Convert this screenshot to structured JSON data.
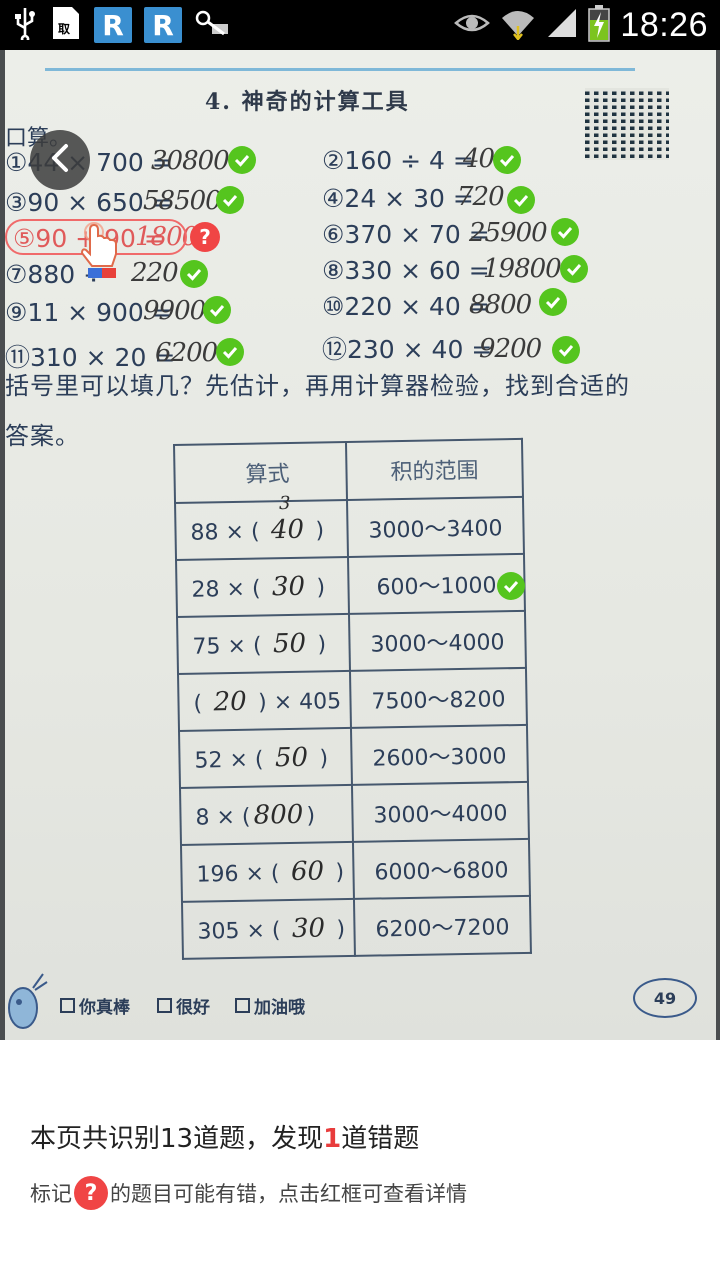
{
  "status_bar": {
    "time": "18:26",
    "left_icons": [
      "usb-icon",
      "document-icon",
      "r-app-icon",
      "r-app-icon",
      "app-icon"
    ],
    "right_icons": [
      "eye-icon",
      "wifi-icon",
      "signal-icon",
      "battery-charging-icon"
    ],
    "r_label": "R",
    "colors": {
      "background": "#000000",
      "r_badge": "#3a8fd0",
      "battery": "#7cc41f"
    }
  },
  "photo": {
    "page_title": "4. 神奇的计算工具",
    "section_label": "口算。",
    "problems": [
      {
        "label": "①44 × 700 =",
        "answer": "30800",
        "status": "correct"
      },
      {
        "label": "②160 ÷ 4 =",
        "answer": "40",
        "status": "correct"
      },
      {
        "label": "③90 × 650 =",
        "answer": "58500",
        "status": "correct"
      },
      {
        "label": "④24 × 30 =",
        "answer": "720",
        "status": "correct"
      },
      {
        "label": "⑤90 + 90 =",
        "answer": "1800",
        "status": "error"
      },
      {
        "label": "⑥370 × 70 =",
        "answer": "25900",
        "status": "correct"
      },
      {
        "label": "⑦880 ÷",
        "answer": "220",
        "status": "correct"
      },
      {
        "label": "⑧330 × 60 =",
        "answer": "19800",
        "status": "correct"
      },
      {
        "label": "⑨11 × 900 =",
        "answer": "9900",
        "status": "correct"
      },
      {
        "label": "⑩220 × 40 =",
        "answer": "8800",
        "status": "correct"
      },
      {
        "label": "⑪310 × 20 =",
        "answer": "6200",
        "status": "correct"
      },
      {
        "label": "⑫230 × 40 =",
        "answer": "9200",
        "status": "correct"
      }
    ],
    "instruction_line1": "括号里可以填几？先估计，再用计算器检验，找到合适的",
    "instruction_line2": "答案。",
    "table": {
      "headers": [
        "算式",
        "积的范围"
      ],
      "rows": [
        {
          "prefix": "88 × (",
          "answer": "40",
          "suffix": ")",
          "range": "3000～3400",
          "extra": "3"
        },
        {
          "prefix": "28 × (",
          "answer": "30",
          "suffix": ")",
          "range": "600～1000"
        },
        {
          "prefix": "75 × (",
          "answer": "50",
          "suffix": ")",
          "range": "3000～4000"
        },
        {
          "prefix": "(",
          "answer": "20",
          "suffix": ") × 405",
          "range": "7500～8200"
        },
        {
          "prefix": "52 × (",
          "answer": "50",
          "suffix": ")",
          "range": "2600～3000"
        },
        {
          "prefix": "8 × (",
          "answer": "800",
          "suffix": ")",
          "range": "3000～4000"
        },
        {
          "prefix": "196 × (",
          "answer": "60",
          "suffix": ")",
          "range": "6000～6800"
        },
        {
          "prefix": "305 × (",
          "answer": "30",
          "suffix": ")",
          "range": "6200～7200"
        }
      ]
    },
    "footer_checkboxes": [
      "你真棒",
      "很好",
      "加油哦"
    ],
    "page_number": "49"
  },
  "result": {
    "summary_prefix": "本页共识别13道题，发现",
    "error_count": "1",
    "summary_suffix": "道错题",
    "hint_prefix": "标记",
    "hint_badge": "?",
    "hint_suffix": "的题目可能有错，点击红框可查看详情"
  },
  "colors": {
    "check": "#55c51e",
    "error": "#f04545",
    "error_frame": "#f06a6a"
  }
}
